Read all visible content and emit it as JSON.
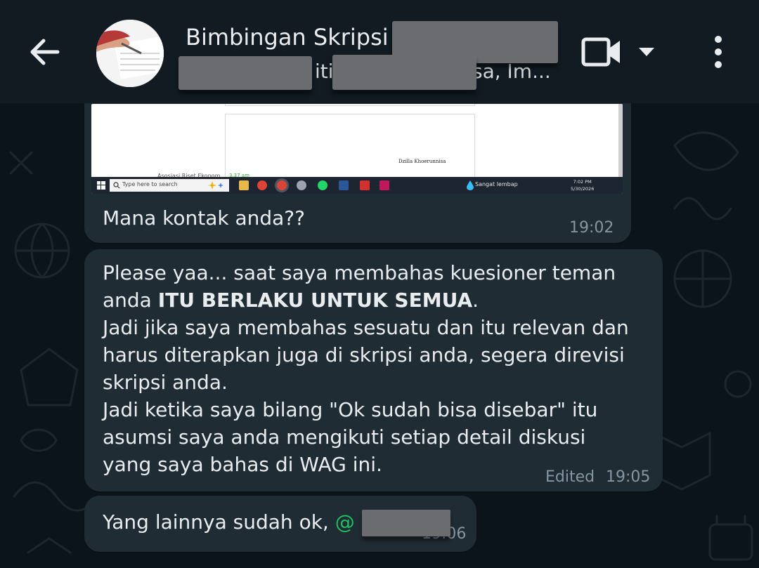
{
  "header": {
    "title": "Bimbingan Skripsi",
    "subtitle_fragment_1": "iti",
    "subtitle_fragment_2": "sa, Im...",
    "icons": [
      "back-arrow-icon",
      "group-avatar",
      "video-camera-icon",
      "chevron-down-icon",
      "more-vertical-icon"
    ]
  },
  "messages": [
    {
      "attachment": {
        "type": "screenshot",
        "author_text": "Dzilla Khoerunnisa",
        "peek_text": "Asosiasi Riset Ekonom",
        "peek_time": "3.37 am",
        "taskbar_search": "Type here to search",
        "weather": "Sangat lembap",
        "clock_time": "7:02 PM",
        "clock_date": "5/30/2026"
      },
      "text": "Mana kontak anda??",
      "time": "19:02"
    },
    {
      "line1": "Please yaa... saat saya membahas kuesioner teman",
      "line2_prefix": "anda ",
      "line2_bold": "ITU BERLAKU UNTUK SEMUA",
      "line2_suffix": ".",
      "line3": "Jadi jika saya membahas sesuatu dan itu relevan dan",
      "line4": "harus diterapkan juga di skripsi anda, segera direvisi",
      "line5": "skripsi anda.",
      "line6": "Jadi ketika saya bilang \"Ok sudah bisa disebar\" itu",
      "line7": "asumsi saya anda mengikuti setiap detail diskusi",
      "line8": "yang saya bahas di WAG ini.",
      "edited_label": "Edited",
      "time": "19:05"
    },
    {
      "text": "Yang lainnya sudah ok, ",
      "mention": "@",
      "time": "19:06"
    }
  ],
  "colors": {
    "background": "#0b141a",
    "header": "#111b21",
    "bubble": "#202c33",
    "text": "#e9edef",
    "meta": "#8696a0",
    "mention": "#21c063"
  }
}
